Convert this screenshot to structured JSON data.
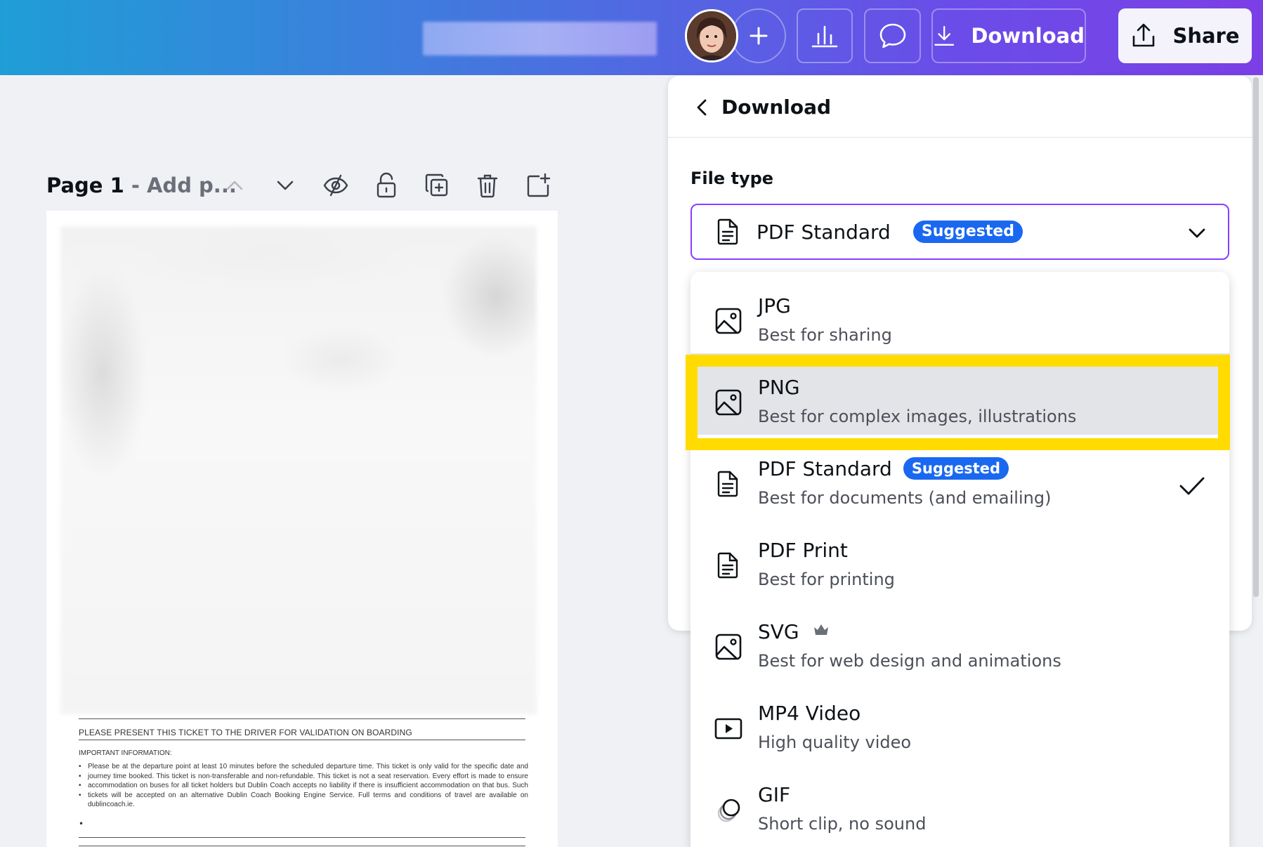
{
  "topbar": {
    "download_label": "Download",
    "share_label": "Share",
    "icons": [
      "plus-icon",
      "insights-icon",
      "comment-icon",
      "download-icon",
      "share-icon"
    ]
  },
  "page_toolbar": {
    "page_label": "Page 1",
    "page_title_placeholder": "- Add p..."
  },
  "document": {
    "heading": "PLEASE PRESENT THIS TICKET TO THE DRIVER FOR VALIDATION ON BOARDING",
    "important_label": "IMPORTANT INFORMATION:",
    "body": "Please be at the departure point at least 10 minutes before the scheduled departure time. This ticket is only valid for the specific date and journey time booked. This ticket is non-transferable and non-refundable. This ticket is not a seat reservation. Every effort is made to ensure accommodation on buses for all ticket holders but Dublin Coach accepts no liability if there is insufficient accommodation on that bus. Such tickets will be accepted on an alternative Dublin Coach Booking Engine Service. Full terms and conditions of travel are available on dublincoach.ie."
  },
  "download_panel": {
    "title": "Download",
    "file_type_label": "File type",
    "selected_file_type": "PDF Standard",
    "selected_badge": "Suggested",
    "options": [
      {
        "name": "JPG",
        "description": "Best for sharing",
        "icon": "image-icon"
      },
      {
        "name": "PNG",
        "description": "Best for complex images, illustrations",
        "icon": "image-icon",
        "highlighted": true
      },
      {
        "name": "PDF Standard",
        "badge": "Suggested",
        "description": "Best for documents (and emailing)",
        "icon": "document-icon",
        "selected": true
      },
      {
        "name": "PDF Print",
        "description": "Best for printing",
        "icon": "document-icon"
      },
      {
        "name": "SVG",
        "description": "Best for web design and animations",
        "icon": "image-icon",
        "premium": true
      },
      {
        "name": "MP4 Video",
        "description": "High quality video",
        "icon": "video-icon"
      },
      {
        "name": "GIF",
        "description": "Short clip, no sound",
        "icon": "gif-icon"
      }
    ]
  },
  "colors": {
    "accent_purple": "#8b3dff",
    "badge_blue": "#1a68f0",
    "highlight_yellow": "#ffdb00"
  }
}
